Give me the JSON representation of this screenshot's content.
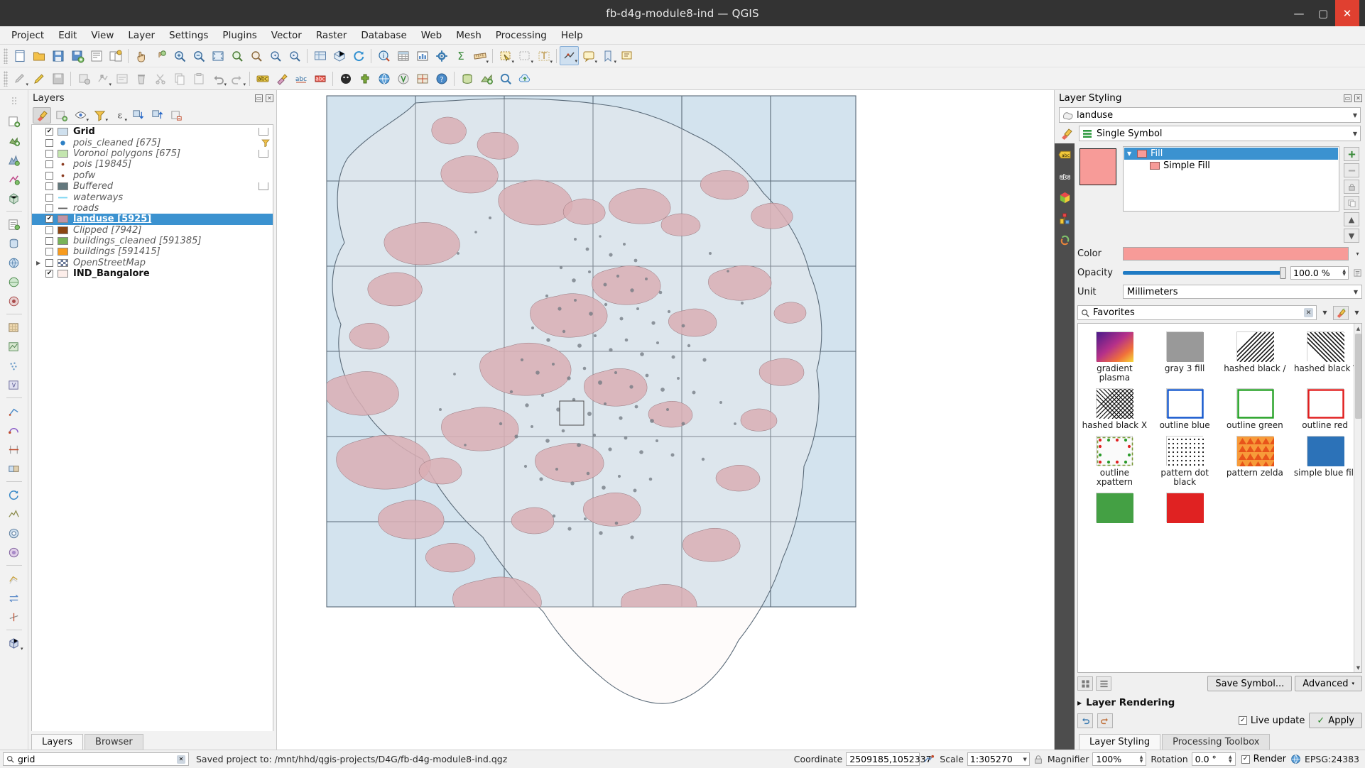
{
  "window": {
    "title": "fb-d4g-module8-ind — QGIS",
    "minimize": "—",
    "maximize": "▢",
    "close": "✕"
  },
  "menubar": {
    "items": [
      "Project",
      "Edit",
      "View",
      "Layer",
      "Settings",
      "Plugins",
      "Vector",
      "Raster",
      "Database",
      "Web",
      "Mesh",
      "Processing",
      "Help"
    ]
  },
  "layers_panel": {
    "title": "Layers",
    "toolbar": [
      {
        "name": "open-layer-styling-panel",
        "glyph": "brush"
      },
      {
        "name": "add-group",
        "glyph": "group"
      },
      {
        "name": "manage-layer-visibility",
        "glyph": "eye"
      },
      {
        "name": "filter-legend-by-map-content",
        "glyph": "funnel"
      },
      {
        "name": "filter-legend-by-expression",
        "glyph": "epsilon"
      },
      {
        "name": "expand-all",
        "glyph": "expand"
      },
      {
        "name": "collapse-all",
        "glyph": "collapse"
      },
      {
        "name": "remove-layer-group",
        "glyph": "remove"
      }
    ],
    "items": [
      {
        "label": "Grid",
        "checked": true,
        "bold": true,
        "style": "fill",
        "color": "#cfe0ee",
        "edit": true
      },
      {
        "label": "pois_cleaned [675]",
        "checked": false,
        "bold": false,
        "style": "dot",
        "color": "#2c7fc4",
        "filter": true
      },
      {
        "label": "Voronoi polygons [675]",
        "checked": false,
        "bold": false,
        "style": "fill",
        "color": "#c4e6af",
        "edit": true
      },
      {
        "label": "pois [19845]",
        "checked": false,
        "bold": false,
        "style": "smalldot",
        "color": "#8b3b20"
      },
      {
        "label": "pofw",
        "checked": false,
        "bold": false,
        "style": "smalldot",
        "color": "#8b3b20"
      },
      {
        "label": "Buffered",
        "checked": false,
        "bold": false,
        "style": "fill",
        "color": "#63787d",
        "edit": true
      },
      {
        "label": "waterways",
        "checked": false,
        "bold": false,
        "style": "line",
        "color": "#79d4f2"
      },
      {
        "label": "roads",
        "checked": false,
        "bold": false,
        "style": "line",
        "color": "#5a5a5a"
      },
      {
        "label": "landuse [5925]",
        "checked": true,
        "bold": false,
        "selected": true,
        "style": "fill",
        "color": "#c194a6"
      },
      {
        "label": "Clipped [7942]",
        "checked": false,
        "bold": false,
        "style": "fill",
        "color": "#8b4513"
      },
      {
        "label": "buildings_cleaned [591385]",
        "checked": false,
        "bold": false,
        "style": "fill",
        "color": "#77b359"
      },
      {
        "label": "buildings [591415]",
        "checked": false,
        "bold": false,
        "style": "fill",
        "color": "#f79b1e"
      },
      {
        "label": "OpenStreetMap",
        "checked": false,
        "bold": false,
        "style": "raster",
        "color": "#6a7a9a",
        "expander": true
      },
      {
        "label": "IND_Bangalore",
        "checked": true,
        "bold": true,
        "style": "fill",
        "color": "#fdeeea"
      }
    ],
    "tabs": [
      {
        "label": "Layers",
        "active": true
      },
      {
        "label": "Browser",
        "active": false
      }
    ]
  },
  "style_dock": {
    "title": "Layer Styling",
    "layer_combo": "landuse",
    "renderer_combo": "Single Symbol",
    "symbol_tree": [
      {
        "label": "Fill",
        "selected": true,
        "depth": 0
      },
      {
        "label": "Simple Fill",
        "selected": false,
        "depth": 1
      }
    ],
    "properties": {
      "color_label": "Color",
      "color_value": "#f79b98",
      "opacity_label": "Opacity",
      "opacity_value": "100.0 %",
      "unit_label": "Unit",
      "unit_value": "Millimeters"
    },
    "search": {
      "value": "Favorites",
      "clear_glyph": "✕"
    },
    "gallery": [
      {
        "label": "gradient plasma",
        "kind": "gradient"
      },
      {
        "label": "gray 3 fill",
        "kind": "solid",
        "color": "#999999"
      },
      {
        "label": "hashed black /",
        "kind": "hatch-fwd"
      },
      {
        "label": "hashed black \\",
        "kind": "hatch-back"
      },
      {
        "label": "hashed black X",
        "kind": "hatch-x"
      },
      {
        "label": "outline blue",
        "kind": "outline",
        "color": "#1155cc"
      },
      {
        "label": "outline green",
        "kind": "outline",
        "color": "#22a022"
      },
      {
        "label": "outline red",
        "kind": "outline",
        "color": "#e01b1b"
      },
      {
        "label": "outline xpattern",
        "kind": "xpattern"
      },
      {
        "label": "pattern dot black",
        "kind": "dots"
      },
      {
        "label": "pattern zelda",
        "kind": "zelda"
      },
      {
        "label": "simple blue fill",
        "kind": "solid",
        "color": "#2c72b8"
      },
      {
        "label": "",
        "kind": "solid",
        "color": "#44a044"
      },
      {
        "label": "",
        "kind": "solid",
        "color": "#e02222"
      }
    ],
    "footer": {
      "save_symbol": "Save Symbol...",
      "advanced": "Advanced",
      "layer_rendering": "Layer Rendering",
      "live_update": "Live update",
      "apply": "Apply",
      "undo_glyph": "↶",
      "redo_glyph": "↷"
    },
    "tabs": [
      {
        "label": "Layer Styling",
        "active": true
      },
      {
        "label": "Processing Toolbox",
        "active": false
      }
    ]
  },
  "statusbar": {
    "search_placeholder": "grid",
    "message": "Saved project to: /mnt/hhd/qgis-projects/D4G/fb-d4g-module8-ind.qgz",
    "coordinate_label": "Coordinate",
    "coordinate_value": "2509185,1052337",
    "scale_label": "Scale",
    "scale_value": "1:305270",
    "magnifier_label": "Magnifier",
    "magnifier_value": "100%",
    "rotation_label": "Rotation",
    "rotation_value": "0.0 °",
    "render_label": "Render",
    "crs_label": "EPSG:24383"
  }
}
